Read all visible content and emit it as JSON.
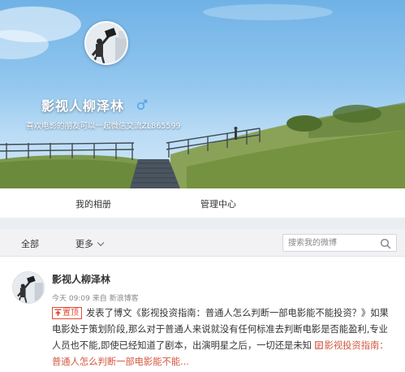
{
  "profile": {
    "name": "影视人柳泽林",
    "bio": "喜欢电影的朋友可以一起微信交流ZL865599",
    "gender": "male"
  },
  "profile_nav": {
    "albums": "我的相册",
    "manage": "管理中心"
  },
  "filter_bar": {
    "all": "全部",
    "more": "更多",
    "search_placeholder": "搜索我的微博"
  },
  "post": {
    "author": "影视人柳泽林",
    "time": "今天 09:09",
    "from": "来自",
    "source": "新浪博客",
    "pin_label": "置顶",
    "text_prefix": "发表了博文",
    "title_quoted": "《影视投资指南：普通人怎么判断一部电影能不能投资？》",
    "text_body": "如果电影处于策划阶段,那么对于普通人来说就没有任何标准去判断电影是否能盈利,专业人员也不能,即使已经知道了剧本，出演明星之后，一切还是未知",
    "link_text": "影视投资指南：普通人怎么判断一部电影能不能..."
  },
  "colors": {
    "accent_red": "#e04b36",
    "link_red": "#d3573e",
    "gender_blue": "#5aa5e8"
  },
  "icons": [
    "male-icon",
    "chevron-down-icon",
    "search-icon",
    "pin-icon",
    "link-icon"
  ]
}
